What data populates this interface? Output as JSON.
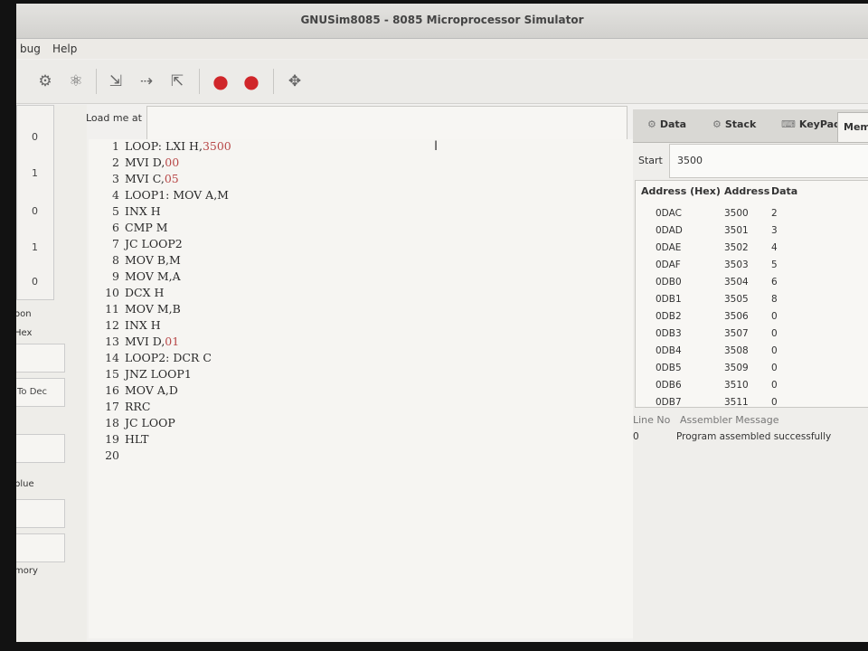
{
  "window": {
    "title": "GNUSim8085 - 8085 Microprocessor Simulator"
  },
  "menu": {
    "items": [
      "bug",
      "Help"
    ]
  },
  "left_panel": {
    "registers": [
      "0",
      "1",
      "0",
      "1",
      "0"
    ],
    "labels": [
      "oon",
      "Hex",
      "To Dec",
      "blue",
      "mory"
    ]
  },
  "load": {
    "label": "Load me at",
    "value": ""
  },
  "editor": {
    "lines": [
      {
        "n": "1",
        "code": "LOOP: LXI H,3500"
      },
      {
        "n": "2",
        "code": "MVI D,00"
      },
      {
        "n": "3",
        "code": "MVI C,05"
      },
      {
        "n": "4",
        "code": "LOOP1: MOV A,M"
      },
      {
        "n": "5",
        "code": "INX H"
      },
      {
        "n": "6",
        "code": "CMP M"
      },
      {
        "n": "7",
        "code": "JC LOOP2"
      },
      {
        "n": "8",
        "code": "MOV B,M"
      },
      {
        "n": "9",
        "code": "MOV M,A"
      },
      {
        "n": "10",
        "code": "DCX H"
      },
      {
        "n": "11",
        "code": "MOV M,B"
      },
      {
        "n": "12",
        "code": "INX H"
      },
      {
        "n": "13",
        "code": "MVI D,01"
      },
      {
        "n": "14",
        "code": "LOOP2: DCR C"
      },
      {
        "n": "15",
        "code": "JNZ LOOP1"
      },
      {
        "n": "16",
        "code": "MOV A,D"
      },
      {
        "n": "17",
        "code": "RRC"
      },
      {
        "n": "18",
        "code": "JC LOOP"
      },
      {
        "n": "19",
        "code": "HLT"
      },
      {
        "n": "20",
        "code": ""
      }
    ]
  },
  "tabs": [
    "Data",
    "Stack",
    "KeyPad",
    "Mem"
  ],
  "memory": {
    "start_label": "Start",
    "start_value": "3500",
    "headers": [
      "Address (Hex)",
      "Address",
      "Data"
    ],
    "rows": [
      [
        "0DAC",
        "3500",
        "2"
      ],
      [
        "0DAD",
        "3501",
        "3"
      ],
      [
        "0DAE",
        "3502",
        "4"
      ],
      [
        "0DAF",
        "3503",
        "5"
      ],
      [
        "0DB0",
        "3504",
        "6"
      ],
      [
        "0DB1",
        "3505",
        "8"
      ],
      [
        "0DB2",
        "3506",
        "0"
      ],
      [
        "0DB3",
        "3507",
        "0"
      ],
      [
        "0DB4",
        "3508",
        "0"
      ],
      [
        "0DB5",
        "3509",
        "0"
      ],
      [
        "0DB6",
        "3510",
        "0"
      ],
      [
        "0DB7",
        "3511",
        "0"
      ]
    ]
  },
  "messages": {
    "headers": [
      "Line No",
      "Assembler Message"
    ],
    "rows": [
      [
        "0",
        "Program assembled successfully"
      ]
    ]
  }
}
